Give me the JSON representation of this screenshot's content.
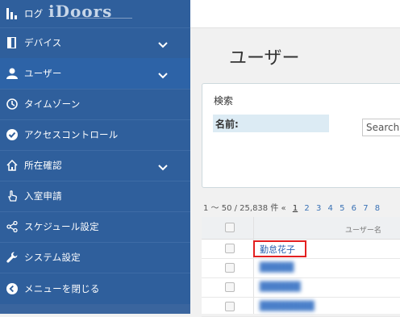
{
  "sidebar": {
    "brand": "iDoors",
    "top_item": {
      "label": "ログ",
      "icon": "bar-chart-icon"
    },
    "items": [
      {
        "label": "デバイス",
        "icon": "device-icon",
        "has_chevron": true
      },
      {
        "label": "ユーザー",
        "icon": "user-icon",
        "has_chevron": true,
        "active": true
      },
      {
        "label": "タイムゾーン",
        "icon": "clock-icon",
        "has_chevron": false
      },
      {
        "label": "アクセスコントロール",
        "icon": "check-circle-icon",
        "has_chevron": false
      },
      {
        "label": "所在確認",
        "icon": "home-icon",
        "has_chevron": true
      },
      {
        "label": "入室申請",
        "icon": "hand-pointer-icon",
        "has_chevron": false
      },
      {
        "label": "スケジュール設定",
        "icon": "share-icon",
        "has_chevron": false
      },
      {
        "label": "システム設定",
        "icon": "wrench-icon",
        "has_chevron": false
      },
      {
        "label": "メニューを閉じる",
        "icon": "chevron-left-circle-icon",
        "has_chevron": false
      }
    ]
  },
  "main": {
    "title": "ユーザー",
    "search_panel": {
      "title": "検索",
      "name_label": "名前:",
      "input_value": "Search"
    },
    "pagination": {
      "summary": "1 〜 50 / 25,838 件",
      "prev": "«",
      "pages": [
        "1",
        "2",
        "3",
        "4",
        "5",
        "6",
        "7",
        "8"
      ],
      "current": "1"
    },
    "table": {
      "column_user": "ユーザー名",
      "rows": [
        {
          "name": "勤怠花子",
          "highlighted": true
        }
      ]
    }
  }
}
